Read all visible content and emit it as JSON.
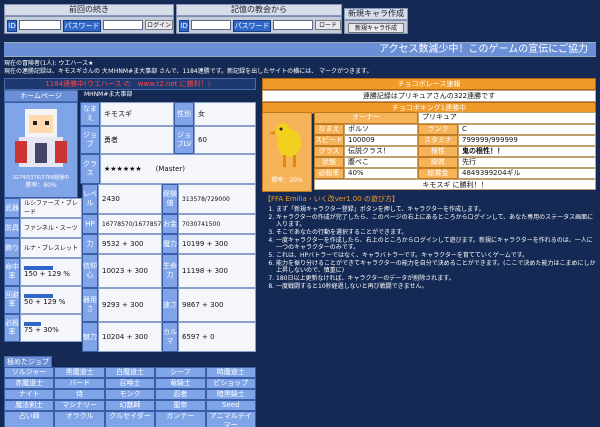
{
  "login": {
    "title": "前回の続き",
    "pw_label": "パスワード",
    "login_button": "ログイン",
    "id_label": "ID"
  },
  "church": {
    "title": "記憶の教会から",
    "pw_label": "パスワード",
    "load_button": "ロード",
    "id_label": "ID"
  },
  "newchar": {
    "title": "新規キャラ作成",
    "button": "新規キャラ作成"
  },
  "banner": "アクセス数減少中！このゲームの宣伝にご協力",
  "info": {
    "line1": "現在の冒険者(1人): ウエハース★",
    "line2": "現在の連勝記録は、キモスギさんの 大ＭHNM#ま大事部 さんで、1184連勝です。新記録を出したサイトの横には、 マークがつきます。"
  },
  "left": {
    "win_text": "1184連勝中(ウエハース の　www.t2.net に勝利！）",
    "homepage": "ホームページ",
    "site_name": "MHNM#ま大事部",
    "exp_caption": "3274/5376/3766経験中",
    "win_rate": "勝率：80%",
    "rows": [
      {
        "l1": "なまえ",
        "v1": "キモスギ",
        "l2": "性別",
        "v2": "女"
      },
      {
        "l1": "ジョブ",
        "v1": "勇者",
        "l2": "ジョブLV",
        "v2": "60"
      },
      {
        "l1": "クラス",
        "v1": "★★★★★★　　(Master)"
      }
    ],
    "side": [
      {
        "label": "武器",
        "value": "ルシファーズ・ブレード"
      },
      {
        "label": "防具",
        "value": "ファンネル・スーツ"
      },
      {
        "label": "飾り",
        "value": "ルナ・ブレスレット"
      }
    ],
    "side_bars": [
      {
        "label": "命中率",
        "value": "150 + 129 %",
        "level": 0.5
      },
      {
        "label": "回避率",
        "value": "50 + 129 %",
        "level": 0.5
      },
      {
        "label": "必殺率",
        "value": "75 + 30%",
        "level": 0.3
      }
    ],
    "stats": [
      {
        "l1": "レベル",
        "v1": "2430",
        "l2": "経験値",
        "v2": "313578/729000"
      },
      {
        "l1": "HP",
        "v1": "16778570/16778570",
        "l2": "お金",
        "v2": "7030741500"
      },
      {
        "l1": "力",
        "v1": "9532 + 300",
        "l2": "魔力",
        "v2": "10199 + 300"
      },
      {
        "l1": "信仰心",
        "v1": "10023 + 300",
        "l2": "生命力",
        "v2": "11198 + 300"
      },
      {
        "l1": "器用さ",
        "v1": "9293 + 300",
        "l2": "速さ",
        "v2": "9867 + 300"
      },
      {
        "l1": "魅力",
        "v1": "10204 + 300",
        "l2": "カルマ",
        "v2": "6597 + 0"
      }
    ],
    "jobs_title": "極めたジョブ",
    "jobs": [
      "ソルジャー",
      "黒魔道士",
      "白魔道士",
      "シーフ",
      "時魔道士",
      "赤魔道士",
      "バード",
      "召喚士",
      "竜騎士",
      "ピショップ",
      "ナイト",
      "侍",
      "モンク",
      "忍者",
      "暗黒騎士",
      "魔法剣士",
      "マシナリー",
      "幻獣師",
      "聖帝",
      "Seed",
      "占い師",
      "オラクル",
      "クルセイダー",
      "ガンナー",
      "アニマルテイマー"
    ]
  },
  "right": {
    "title": "チョコボレース速報",
    "record": "連勝記録はプリキュアさんの322連勝です",
    "ranking": "チョコボキング1連勝中",
    "owner_label": "オーナー",
    "owner": "プリキュア",
    "win_rate": "勝率：20%",
    "rows": [
      {
        "l1": "なまえ",
        "v1": "ポルソ",
        "l2": "ランク",
        "v2": "C"
      },
      {
        "l1": "スピード",
        "v1": "100009",
        "l2": "スタミナ",
        "v2": "799999/999999"
      },
      {
        "l1": "クラス",
        "v1": "伝説クラス！",
        "l2": "根性",
        "v2": "鬼の根性！！"
      },
      {
        "l1": "状態",
        "v1": "腹ぺこ",
        "l2": "脚質",
        "v2": "先行"
      },
      {
        "l1": "必殺率",
        "v1": "40%",
        "l2": "総賞金",
        "v2": "4849399204ギル"
      }
    ],
    "winner": "キモスギ に勝利！！",
    "howto_title": "【FFA Emilia・いく改ver1.00 の遊び方】",
    "howto": [
      "まず「新規キャラクター登録」ボタンを押して、キャラクターを作成します。",
      "キャラクターの作成が完了したら、このページの右上にあるところからログインして、あなた専用のステータス画面に入ります。",
      "そこであなたの行動を選択することができます。",
      "一度キャラクターを作成したら、右上のところからログインして遊びます。新規にキャラクターを作れるのは、一人に一つのキャラクターのみです。",
      "これは、HPバトラーではなく、キャラバトラーです。キャラクターを育てていくゲームです。",
      "能力を振り分けることができてキャラクターの能力を自分で決めることができます。(ここで決めた能力はこまめにしか上昇しないので、慎重に)",
      "180日以上更新なければ、キャラクターのデータが削除されます。",
      "一度戦闘すると10秒経過しないと再び戦闘できません。"
    ]
  }
}
